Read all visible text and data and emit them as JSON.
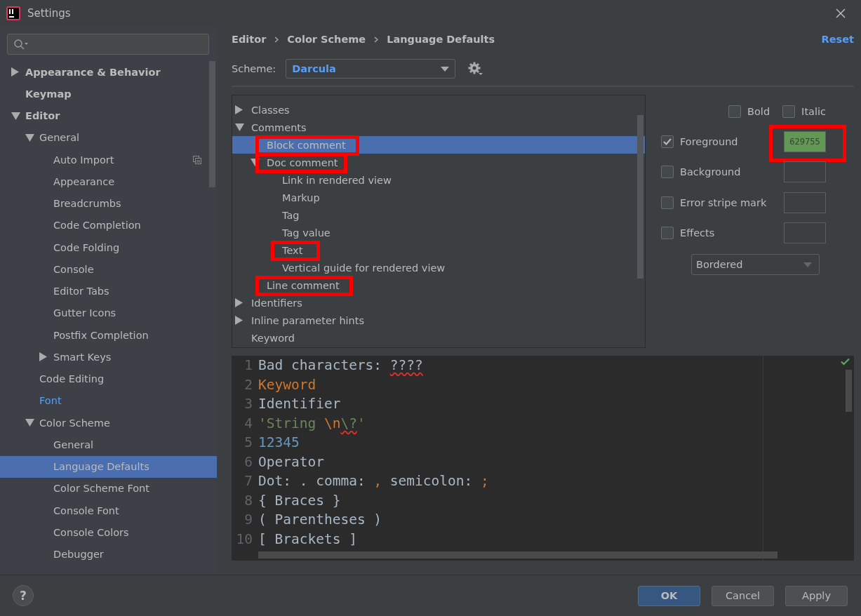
{
  "window": {
    "title": "Settings"
  },
  "sidebar": {
    "items": [
      {
        "label": "Appearance & Behavior",
        "selected": false,
        "modified": false,
        "expanded": false
      },
      {
        "label": "Keymap",
        "selected": false,
        "modified": false
      },
      {
        "label": "Editor",
        "selected": false,
        "modified": false,
        "expanded": true,
        "children": [
          {
            "label": "General",
            "selected": false,
            "modified": false,
            "expanded": true,
            "children": [
              {
                "label": "Auto Import",
                "selected": false,
                "modified": false,
                "project_icon": true
              },
              {
                "label": "Appearance",
                "selected": false,
                "modified": false
              },
              {
                "label": "Breadcrumbs",
                "selected": false,
                "modified": false
              },
              {
                "label": "Code Completion",
                "selected": false,
                "modified": false
              },
              {
                "label": "Code Folding",
                "selected": false,
                "modified": false
              },
              {
                "label": "Console",
                "selected": false,
                "modified": false
              },
              {
                "label": "Editor Tabs",
                "selected": false,
                "modified": false
              },
              {
                "label": "Gutter Icons",
                "selected": false,
                "modified": false
              },
              {
                "label": "Postfix Completion",
                "selected": false,
                "modified": false
              },
              {
                "label": "Smart Keys",
                "selected": false,
                "modified": false,
                "expanded": false
              }
            ]
          },
          {
            "label": "Code Editing",
            "selected": false,
            "modified": false
          },
          {
            "label": "Font",
            "selected": false,
            "modified": true
          },
          {
            "label": "Color Scheme",
            "selected": false,
            "modified": false,
            "expanded": true,
            "children": [
              {
                "label": "General",
                "selected": false,
                "modified": false
              },
              {
                "label": "Language Defaults",
                "selected": true,
                "modified": false
              },
              {
                "label": "Color Scheme Font",
                "selected": false,
                "modified": false
              },
              {
                "label": "Console Font",
                "selected": false,
                "modified": false
              },
              {
                "label": "Console Colors",
                "selected": false,
                "modified": false
              },
              {
                "label": "Debugger",
                "selected": false,
                "modified": false
              }
            ]
          }
        ]
      }
    ]
  },
  "breadcrumb": [
    "Editor",
    "Color Scheme",
    "Language Defaults"
  ],
  "reset_link": "Reset",
  "scheme": {
    "label": "Scheme:",
    "value": "Darcula"
  },
  "attributes_tree": {
    "items": [
      {
        "label": "Classes",
        "selected": false,
        "marked": false,
        "expanded": false
      },
      {
        "label": "Comments",
        "selected": false,
        "marked": false,
        "expanded": true,
        "children": [
          {
            "label": "Block comment",
            "selected": true,
            "marked": true
          },
          {
            "label": "Doc comment",
            "selected": false,
            "marked": true,
            "expanded": true,
            "children": [
              {
                "label": "Link in rendered view",
                "selected": false,
                "marked": false
              },
              {
                "label": "Markup",
                "selected": false,
                "marked": false
              },
              {
                "label": "Tag",
                "selected": false,
                "marked": false
              },
              {
                "label": "Tag value",
                "selected": false,
                "marked": false
              },
              {
                "label": "Text",
                "selected": false,
                "marked": true
              },
              {
                "label": "Vertical guide for rendered view",
                "selected": false,
                "marked": false
              }
            ]
          },
          {
            "label": "Line comment",
            "selected": false,
            "marked": true
          }
        ]
      },
      {
        "label": "Identifiers",
        "selected": false,
        "marked": false,
        "expanded": false
      },
      {
        "label": "Inline parameter hints",
        "selected": false,
        "marked": false,
        "expanded": false
      },
      {
        "label": "Keyword",
        "selected": false,
        "marked": false
      }
    ]
  },
  "font_style": [
    {
      "label": "Bold",
      "checked": false
    },
    {
      "label": "Italic",
      "checked": false
    }
  ],
  "attributes": [
    {
      "label": "Foreground",
      "checked": true,
      "value": "629755",
      "color": "#629755",
      "marked": true
    },
    {
      "label": "Background",
      "checked": false,
      "marked": false
    },
    {
      "label": "Error stripe mark",
      "checked": false,
      "marked": false
    },
    {
      "label": "Effects",
      "checked": false,
      "marked": false
    }
  ],
  "effects_dropdown": {
    "value": "Bordered"
  },
  "preview": {
    "lines": [
      {
        "number": "1",
        "tokens": [
          {
            "kind": "plain",
            "text": "Bad characters: "
          },
          {
            "kind": "bad",
            "text": "????"
          }
        ]
      },
      {
        "number": "2",
        "tokens": [
          {
            "kind": "keyword",
            "text": "Keyword"
          }
        ]
      },
      {
        "number": "3",
        "tokens": [
          {
            "kind": "plain",
            "text": "Identifier"
          }
        ]
      },
      {
        "number": "4",
        "tokens": [
          {
            "kind": "string",
            "text": "'String "
          },
          {
            "kind": "escape",
            "text": "\\n"
          },
          {
            "kind": "bad_escape",
            "text": "\\?"
          },
          {
            "kind": "string",
            "text": "'"
          }
        ]
      },
      {
        "number": "5",
        "tokens": [
          {
            "kind": "number",
            "text": "12345"
          }
        ]
      },
      {
        "number": "6",
        "tokens": [
          {
            "kind": "plain",
            "text": "Operator"
          }
        ]
      },
      {
        "number": "7",
        "tokens": [
          {
            "kind": "plain",
            "text": "Dot: . comma: "
          },
          {
            "kind": "punct",
            "text": ","
          },
          {
            "kind": "plain",
            "text": " semicolon: "
          },
          {
            "kind": "punct",
            "text": ";"
          }
        ]
      },
      {
        "number": "8",
        "tokens": [
          {
            "kind": "plain",
            "text": "{ Braces }"
          }
        ]
      },
      {
        "number": "9",
        "tokens": [
          {
            "kind": "plain",
            "text": "( Parentheses )"
          }
        ]
      },
      {
        "number": "10",
        "tokens": [
          {
            "kind": "plain",
            "text": "[ Brackets ]"
          }
        ]
      }
    ]
  },
  "footer": {
    "help": "?",
    "buttons": [
      {
        "label": "OK",
        "default": true
      },
      {
        "label": "Cancel",
        "default": false
      },
      {
        "label": "Apply",
        "default": false
      }
    ]
  }
}
